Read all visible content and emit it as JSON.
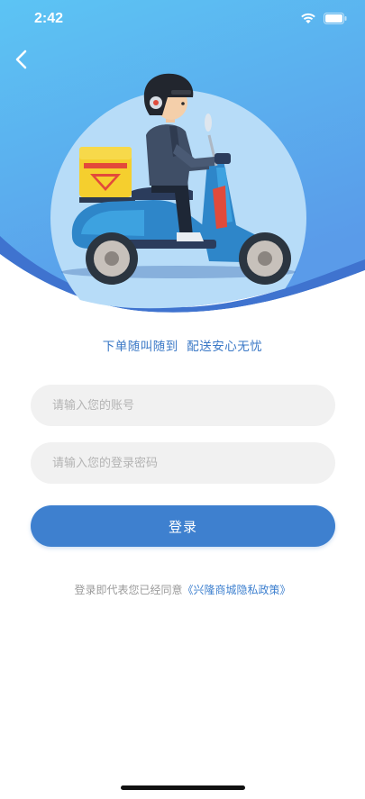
{
  "status_bar": {
    "time": "2:42",
    "wifi_icon": "wifi-icon",
    "battery_icon": "battery-icon"
  },
  "header": {
    "back_icon": "chevron-left-icon"
  },
  "colors": {
    "hero_gradient_top": "#5cc2f3",
    "hero_gradient_bottom": "#5b9bea",
    "accent": "#3e80cf",
    "slogan": "#3a78c6",
    "field_bg": "#f1f1f1"
  },
  "illustration": "delivery-scooter-rider-illustration",
  "slogan": "下单随叫随到  配送安心无忧",
  "form": {
    "account_placeholder": "请输入您的账号",
    "password_placeholder": "请输入您的登录密码",
    "login_label": "登录"
  },
  "agreement": {
    "prefix": "登录即代表您已经同意",
    "policy_link": "《兴隆商城隐私政策》"
  }
}
